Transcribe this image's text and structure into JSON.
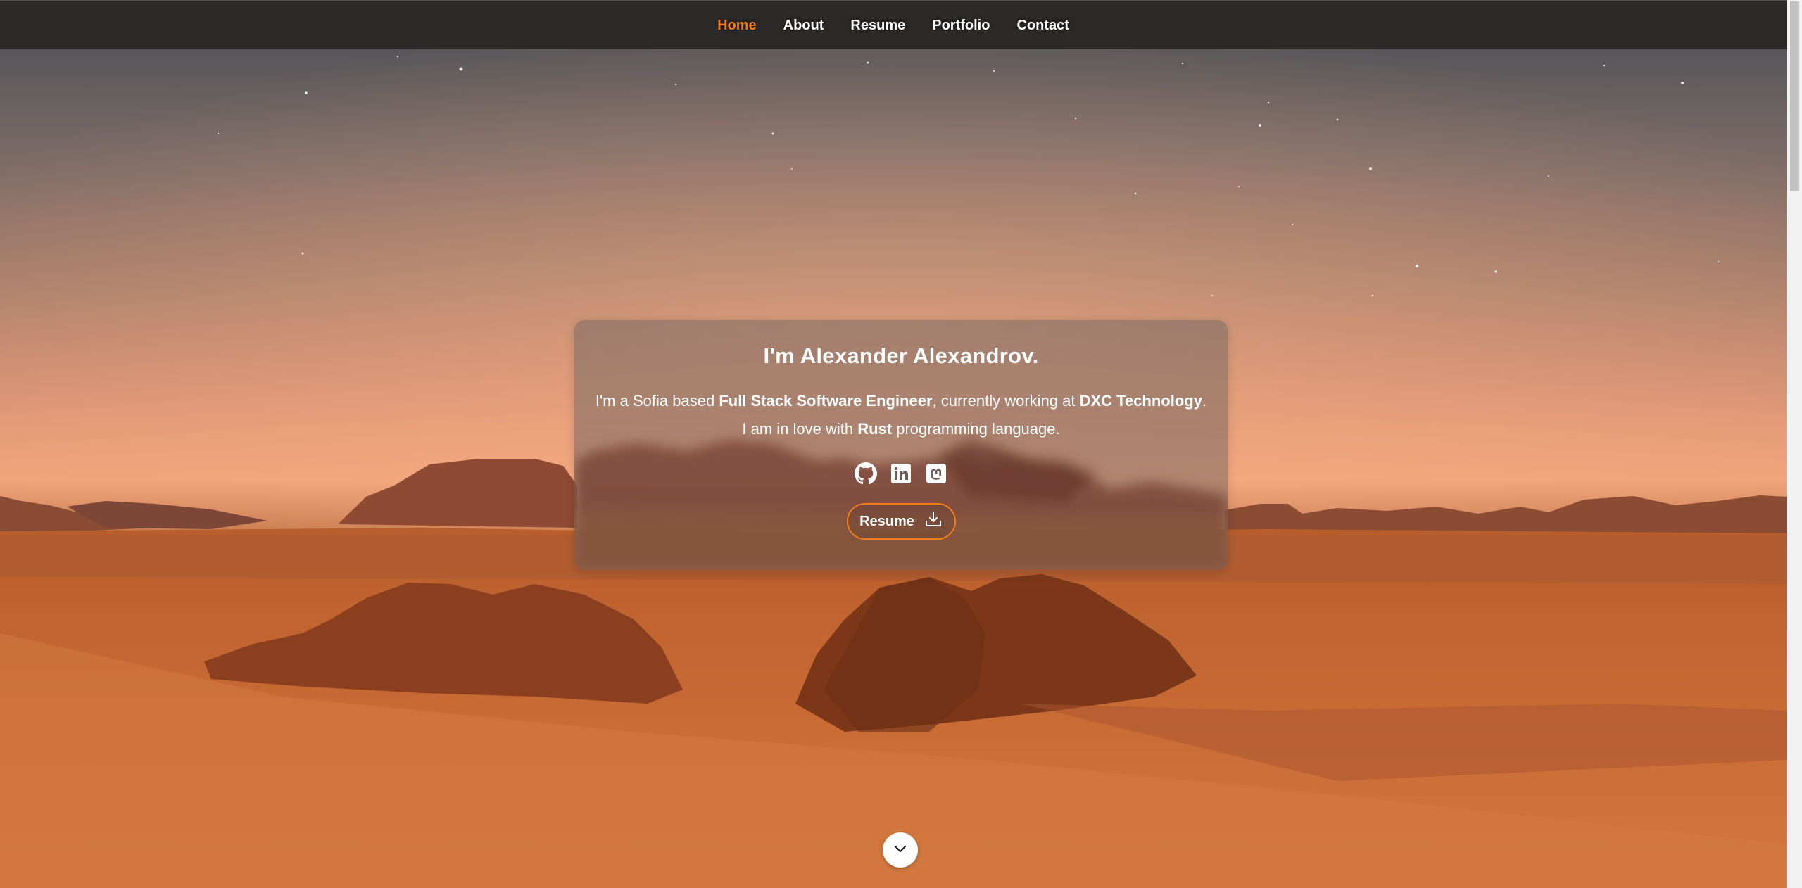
{
  "nav": {
    "items": [
      {
        "label": "Home",
        "active": true
      },
      {
        "label": "About",
        "active": false
      },
      {
        "label": "Resume",
        "active": false
      },
      {
        "label": "Portfolio",
        "active": false
      },
      {
        "label": "Contact",
        "active": false
      }
    ]
  },
  "intro": {
    "title": "I'm Alexander Alexandrov.",
    "line1": {
      "prefix": "I'm a Sofia based ",
      "role": "Full Stack Software Engineer",
      "middle": ", currently working at ",
      "company": "DXC Technology",
      "suffix": "."
    },
    "line2": {
      "prefix": "I am in love with ",
      "language": "Rust",
      "suffix": " programming language."
    },
    "social_icons": [
      "github-icon",
      "linkedin-icon",
      "mastodon-icon"
    ],
    "resume_button_label": "Resume"
  },
  "colors": {
    "accent": "#f57c16",
    "navbar_bg": "#2b2a29",
    "nav_text": "#ffffff"
  }
}
